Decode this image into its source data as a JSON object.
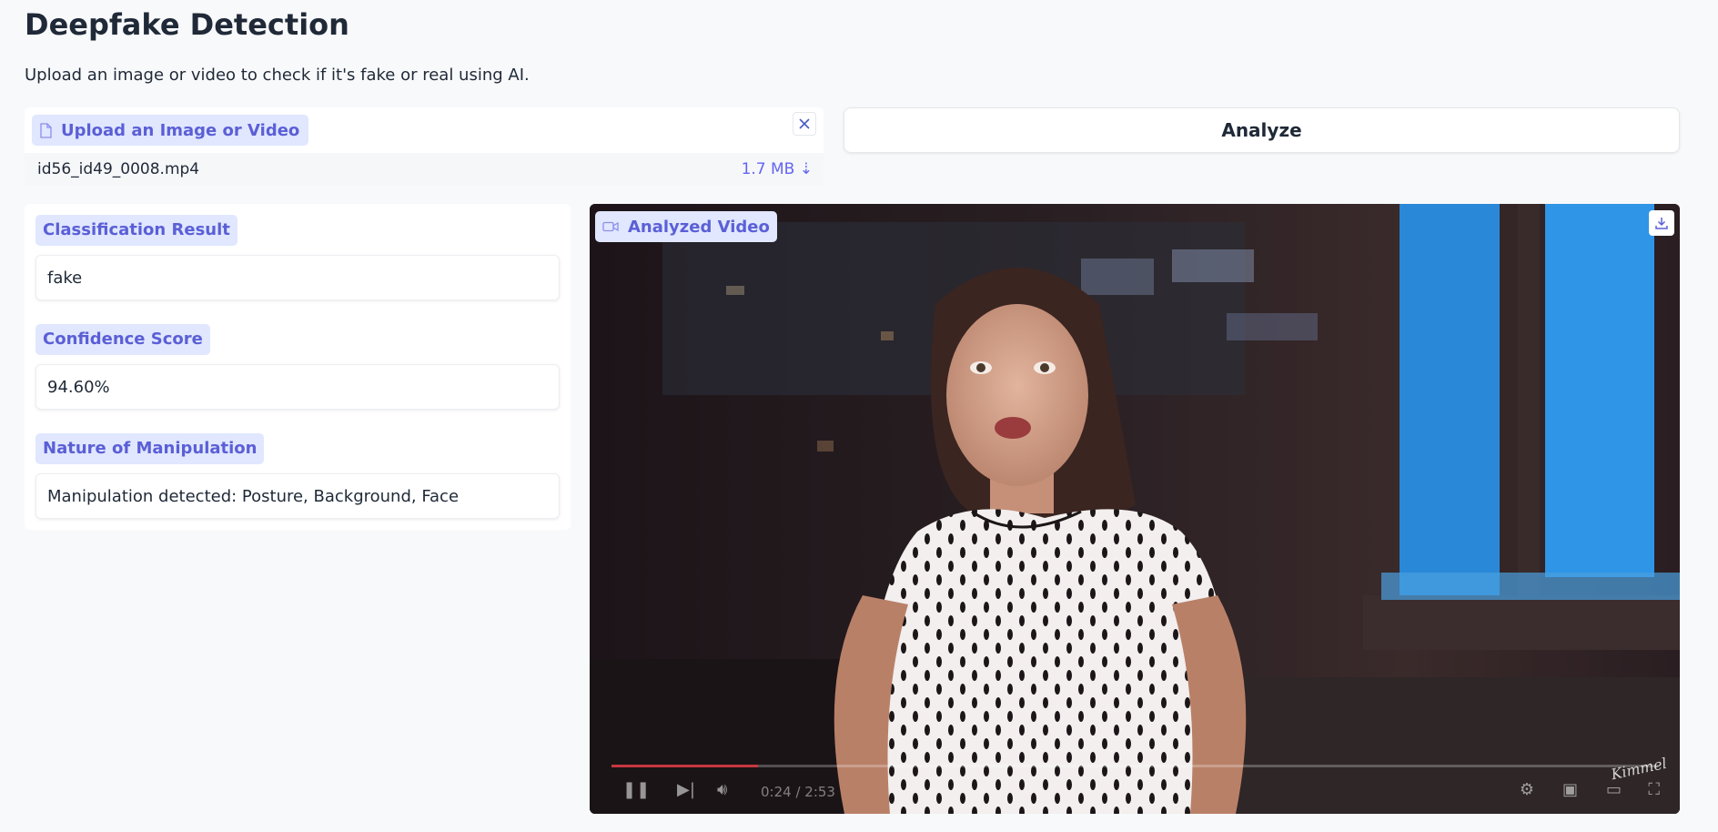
{
  "header": {
    "title": "Deepfake Detection",
    "subtitle": "Upload an image or video to check if it's fake or real using AI."
  },
  "upload": {
    "label": "Upload an Image or Video",
    "icon": "file-icon",
    "close_icon": "close-icon",
    "file_name": "id56_id49_0008.mp4",
    "file_size": "1.7 MB ⇣"
  },
  "actions": {
    "analyze_label": "Analyze"
  },
  "results": {
    "classification_label": "Classification Result",
    "classification_value": "fake",
    "confidence_label": "Confidence Score",
    "confidence_value": "94.60%",
    "manipulation_label": "Nature of Manipulation",
    "manipulation_value": "Manipulation detected: Posture, Background, Face"
  },
  "video": {
    "label": "Analyzed Video",
    "icon": "video-camera-icon",
    "download_icon": "download-icon",
    "time": "0:24 / 2:53",
    "progress": 0.14,
    "watermark": "Kimmel"
  },
  "colors": {
    "accent": "#6366f1",
    "label_bg": "#e0e7ff",
    "page_bg": "#f8f9fb"
  }
}
